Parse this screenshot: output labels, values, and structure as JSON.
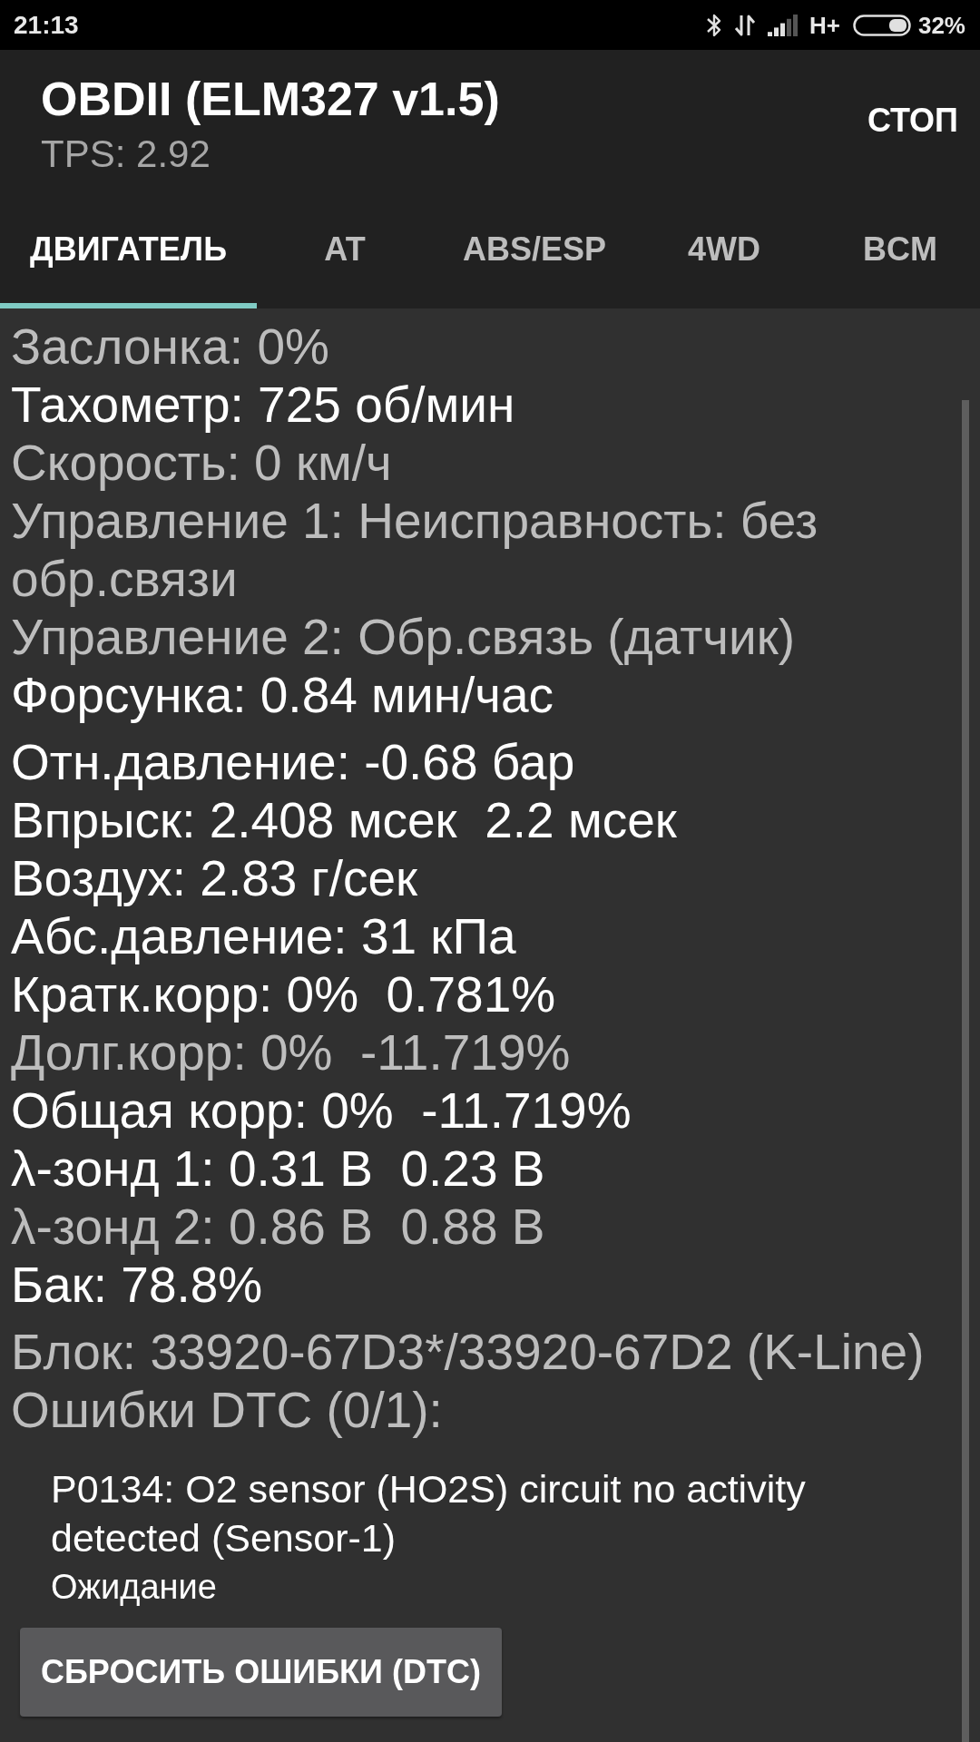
{
  "status_bar": {
    "time": "21:13",
    "network": "H+",
    "battery": "32%"
  },
  "app_bar": {
    "title": "OBDII (ELM327 v1.5)",
    "subtitle": "TPS: 2.92",
    "action": "СТОП"
  },
  "tabs": [
    {
      "label": "ДВИГАТЕЛЬ",
      "selected": true
    },
    {
      "label": "AT",
      "selected": false
    },
    {
      "label": "ABS/ESP",
      "selected": false
    },
    {
      "label": "4WD",
      "selected": false
    },
    {
      "label": "BCM",
      "selected": false
    }
  ],
  "sections": [
    {
      "lines": [
        {
          "text": "Заслонка: 0%",
          "dimmed": true
        },
        {
          "text": "Тахометр: 725 об/мин",
          "dimmed": false
        },
        {
          "text": "Скорость: 0 км/ч",
          "dimmed": true
        },
        {
          "text": "Управление 1: Неисправность: без обр.связи",
          "dimmed": true
        },
        {
          "text": "Управление 2: Обр.связь (датчик)",
          "dimmed": true
        },
        {
          "text": "Форсунка: 0.84 мин/час",
          "dimmed": false
        }
      ]
    },
    {
      "lines": [
        {
          "text": "Отн.давление: -0.68 бар",
          "dimmed": false
        },
        {
          "text": "Впрыск: 2.408 мсек  2.2 мсек",
          "dimmed": false
        },
        {
          "text": "Воздух: 2.83 г/сек",
          "dimmed": false
        },
        {
          "text": "Абс.давление: 31 кПа",
          "dimmed": false
        },
        {
          "text": "Кратк.корр: 0%  0.781%",
          "dimmed": false
        },
        {
          "text": "Долг.корр: 0%  -11.719%",
          "dimmed": true
        },
        {
          "text": "Общая корр: 0%  -11.719%",
          "dimmed": false
        },
        {
          "text": "λ-зонд 1: 0.31 В  0.23 В",
          "dimmed": false
        },
        {
          "text": "λ-зонд 2: 0.86 В  0.88 В",
          "dimmed": true
        },
        {
          "text": "Бак: 78.8%",
          "dimmed": false
        }
      ]
    },
    {
      "lines": [
        {
          "text": "Блок: 33920-67D3*/33920-67D2 (K-Line)",
          "dimmed": true
        },
        {
          "text": "Ошибки DTC (0/1):",
          "dimmed": true
        }
      ]
    }
  ],
  "dtc_list": [
    {
      "description": "P0134: O2 sensor (HO2S) circuit no activity detected (Sensor-1)",
      "status": "Ожидание"
    }
  ],
  "reset_button": {
    "label": "СБРОСИТЬ ОШИБКИ (DTC)"
  }
}
